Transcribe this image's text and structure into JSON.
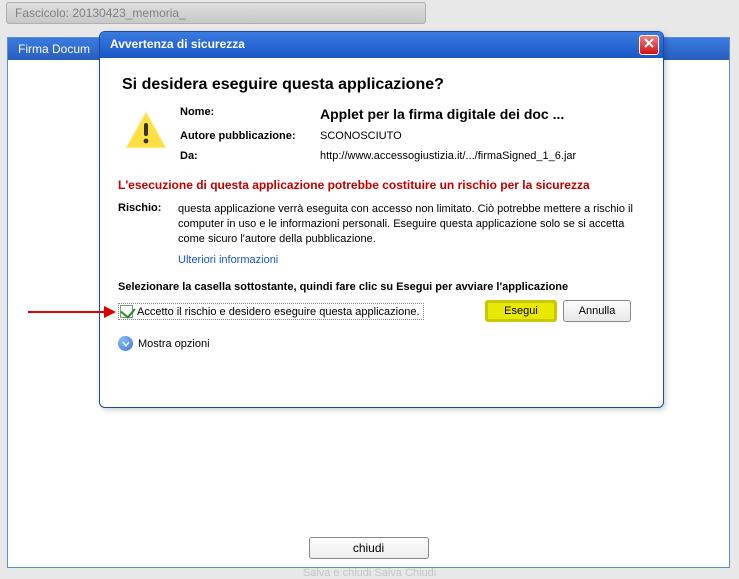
{
  "background": {
    "fascicolo_title": "Fascicolo: 20130423_memoria_",
    "bottom_strip": "Salva e chiudi        Salva        Chiudi"
  },
  "firma_window": {
    "title": "Firma Docum",
    "close_button": "chiudi"
  },
  "dialog": {
    "title": "Avvertenza di sicurezza",
    "heading": "Si desidera eseguire questa applicazione?",
    "fields": {
      "name_label": "Nome:",
      "name_value": "Applet per la firma digitale dei doc ...",
      "publisher_label": "Autore pubblicazione:",
      "publisher_value": "SCONOSCIUTO",
      "from_label": "Da:",
      "from_value": "http://www.accessogiustizia.it/.../firmaSigned_1_6.jar"
    },
    "red_warning": "L'esecuzione di questa applicazione potrebbe costituire un rischio per la sicurezza",
    "risk_label": "Rischio:",
    "risk_text": "questa applicazione verrà eseguita con accesso non limitato. Ciò potrebbe mettere a rischio il computer in uso e le informazioni personali. Eseguire questa applicazione solo se si accetta come sicuro l'autore della pubblicazione.",
    "more_info": "Ulteriori informazioni",
    "select_instruction": "Selezionare la casella sottostante, quindi fare clic su Esegui per avviare l'applicazione",
    "accept_label": "Accetto il rischio e desidero eseguire questa applicazione.",
    "accept_checked": true,
    "run_button": "Esegui",
    "cancel_button": "Annulla",
    "show_options": "Mostra opzioni"
  }
}
